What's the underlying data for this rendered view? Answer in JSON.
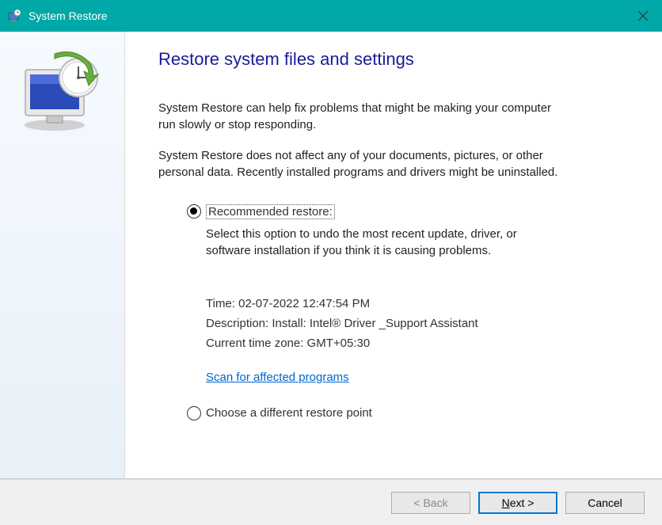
{
  "titlebar": {
    "title": "System Restore"
  },
  "main": {
    "heading": "Restore system files and settings",
    "intro1": "System Restore can help fix problems that might be making your computer run slowly or stop responding.",
    "intro2": "System Restore does not affect any of your documents, pictures, or other personal data. Recently installed programs and drivers might be uninstalled."
  },
  "options": {
    "recommended": {
      "label": "Recommended restore:",
      "desc": "Select this option to undo the most recent update, driver, or software installation if you think it is causing problems.",
      "time": "Time: 02-07-2022 12:47:54 PM",
      "description_line": "Description: Install: Intel® Driver _Support Assistant",
      "timezone": "Current time zone: GMT+05:30",
      "scan_link": "Scan for affected programs"
    },
    "different": {
      "label": "Choose a different restore point"
    }
  },
  "footer": {
    "back": "< Back",
    "next": "Next >",
    "cancel": "Cancel"
  }
}
